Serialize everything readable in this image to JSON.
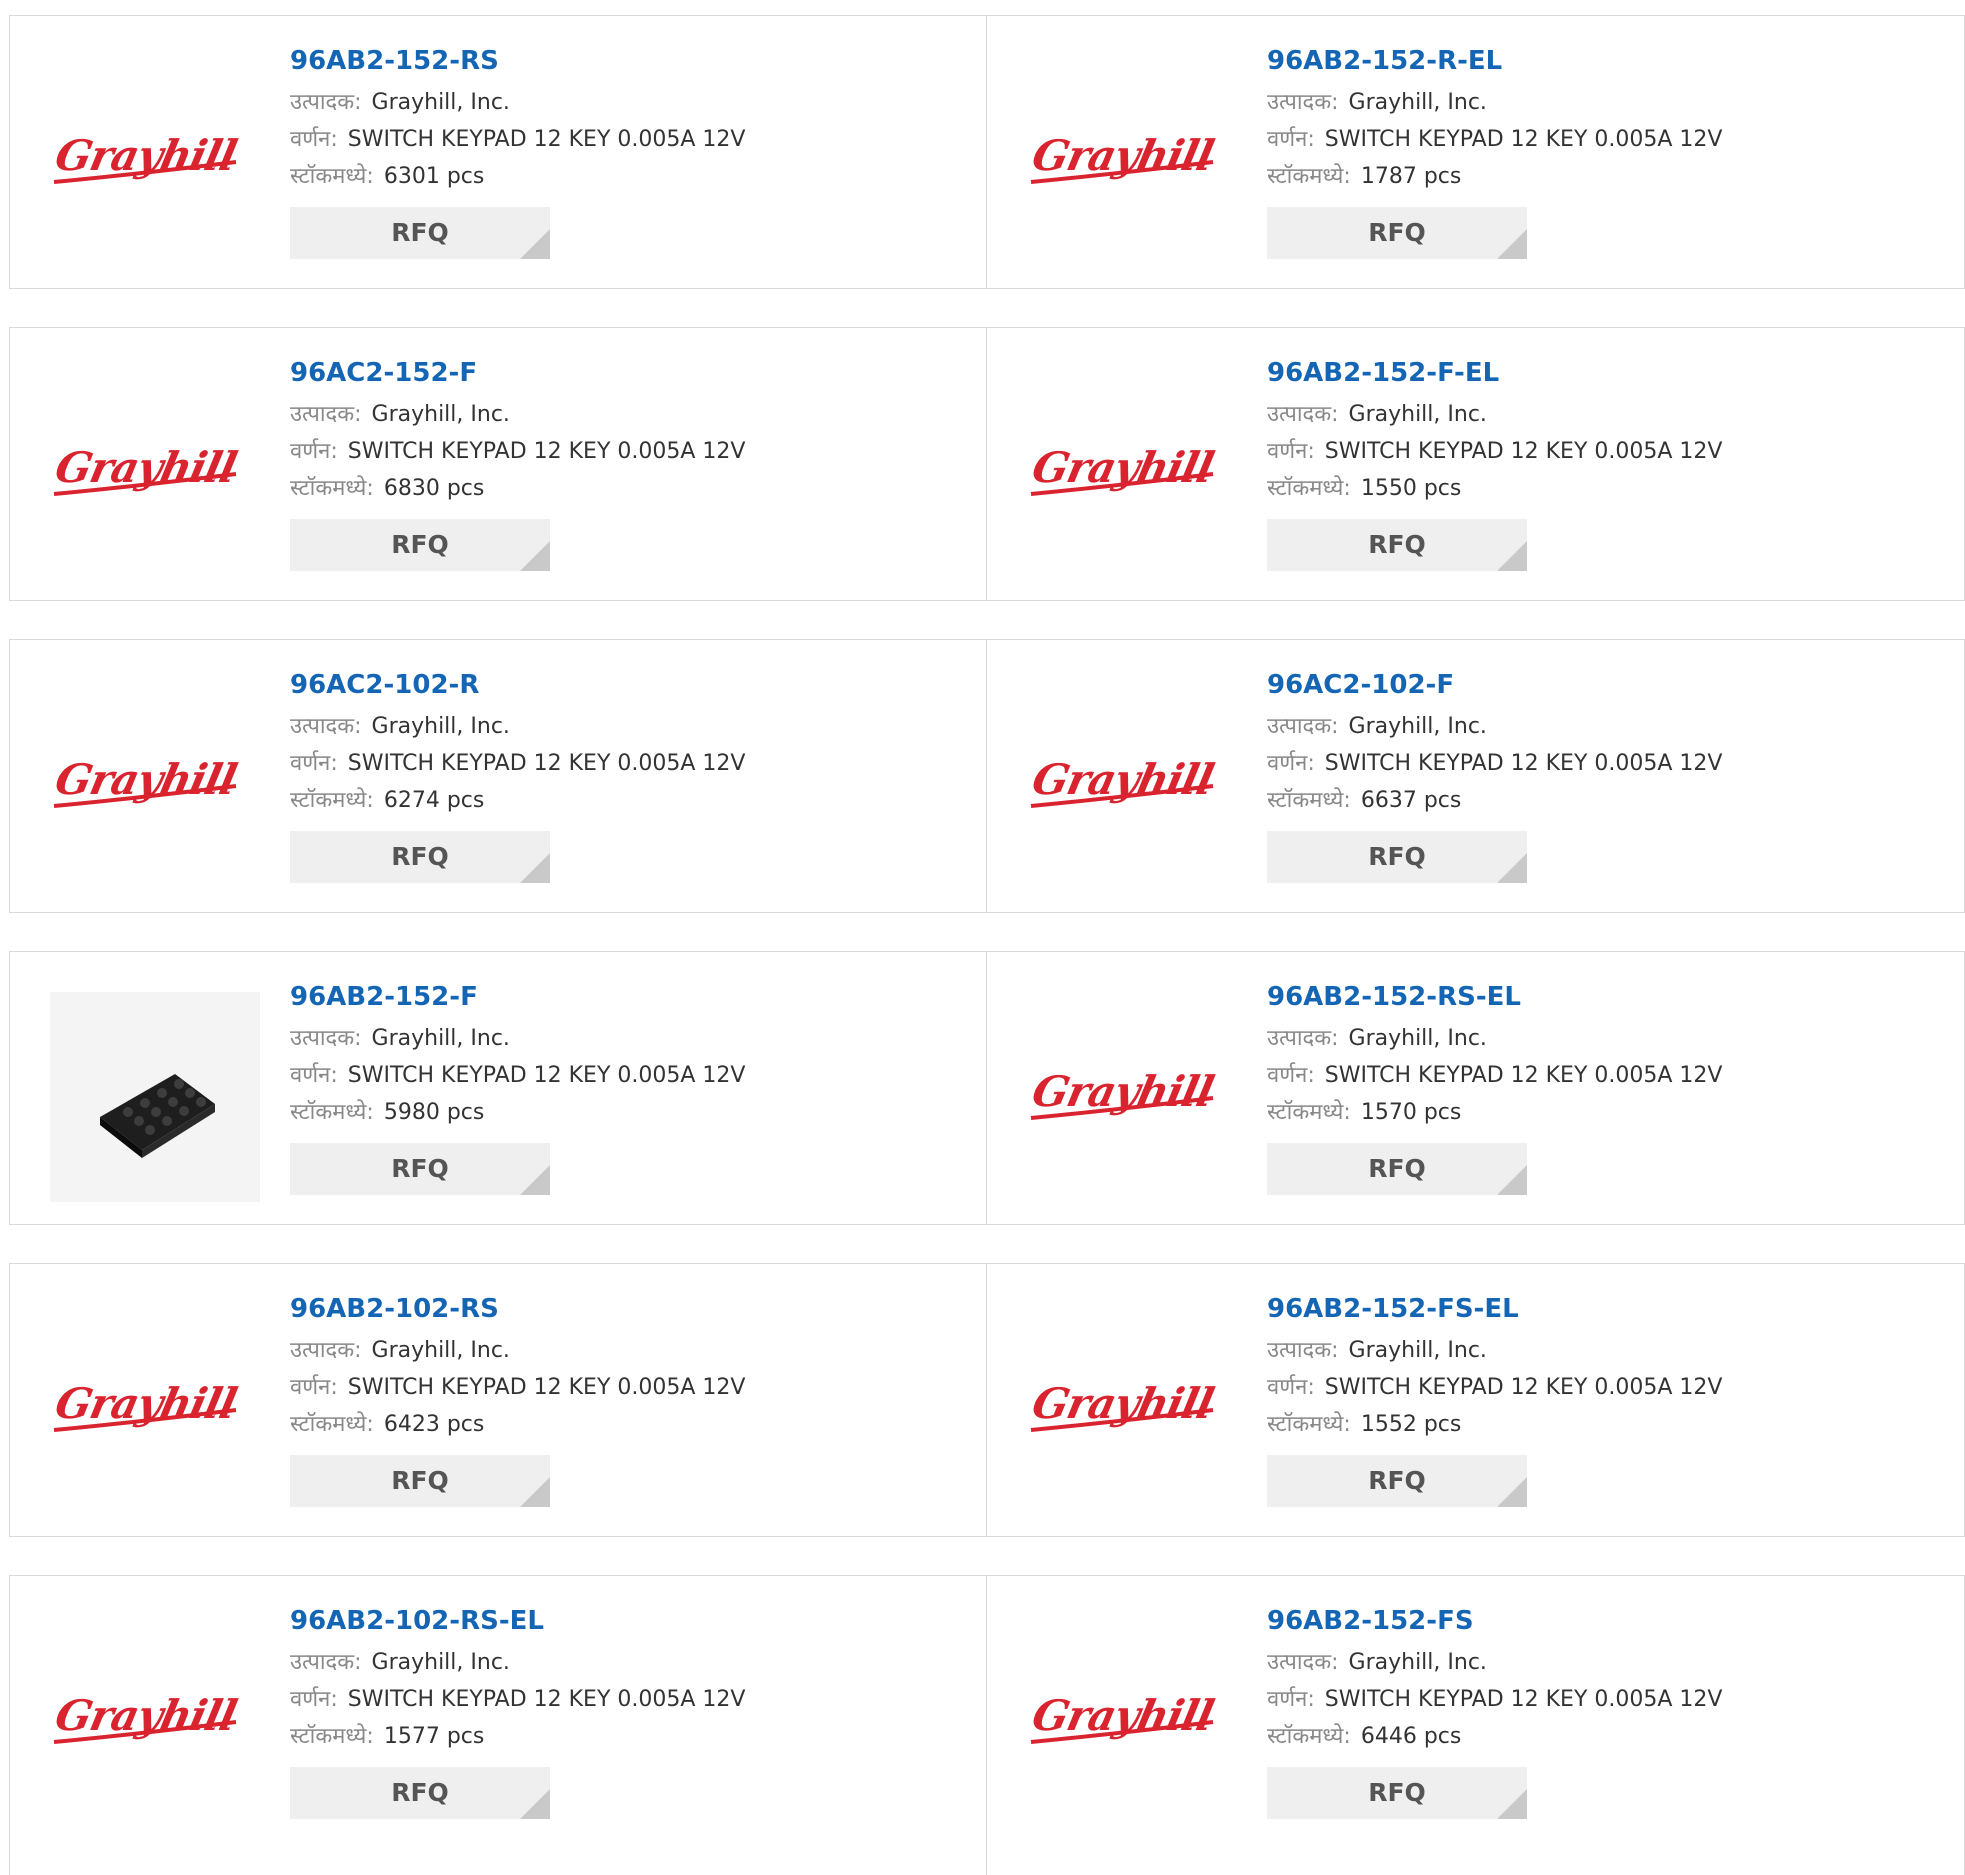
{
  "labels": {
    "manufacturer": "उत्पादक:",
    "description": "वर्णन:",
    "stock": "स्टॉकमध्ये:",
    "rfq": "RFQ"
  },
  "brand_color": "#d9232e",
  "link_color": "#1565b5",
  "logo_text": "Grayhill",
  "products": [
    {
      "part": "96AB2-152-RS",
      "manufacturer": "Grayhill, Inc.",
      "description": "SWITCH KEYPAD 12 KEY 0.005A 12V",
      "stock": "6301 pcs",
      "image": "grayhill-logo"
    },
    {
      "part": "96AB2-152-R-EL",
      "manufacturer": "Grayhill, Inc.",
      "description": "SWITCH KEYPAD 12 KEY 0.005A 12V",
      "stock": "1787 pcs",
      "image": "grayhill-logo"
    },
    {
      "part": "96AC2-152-F",
      "manufacturer": "Grayhill, Inc.",
      "description": "SWITCH KEYPAD 12 KEY 0.005A 12V",
      "stock": "6830 pcs",
      "image": "grayhill-logo"
    },
    {
      "part": "96AB2-152-F-EL",
      "manufacturer": "Grayhill, Inc.",
      "description": "SWITCH KEYPAD 12 KEY 0.005A 12V",
      "stock": "1550 pcs",
      "image": "grayhill-logo"
    },
    {
      "part": "96AC2-102-R",
      "manufacturer": "Grayhill, Inc.",
      "description": "SWITCH KEYPAD 12 KEY 0.005A 12V",
      "stock": "6274 pcs",
      "image": "grayhill-logo"
    },
    {
      "part": "96AC2-102-F",
      "manufacturer": "Grayhill, Inc.",
      "description": "SWITCH KEYPAD 12 KEY 0.005A 12V",
      "stock": "6637 pcs",
      "image": "grayhill-logo"
    },
    {
      "part": "96AB2-152-F",
      "manufacturer": "Grayhill, Inc.",
      "description": "SWITCH KEYPAD 12 KEY 0.005A 12V",
      "stock": "5980 pcs",
      "image": "keypad-photo"
    },
    {
      "part": "96AB2-152-RS-EL",
      "manufacturer": "Grayhill, Inc.",
      "description": "SWITCH KEYPAD 12 KEY 0.005A 12V",
      "stock": "1570 pcs",
      "image": "grayhill-logo"
    },
    {
      "part": "96AB2-102-RS",
      "manufacturer": "Grayhill, Inc.",
      "description": "SWITCH KEYPAD 12 KEY 0.005A 12V",
      "stock": "6423 pcs",
      "image": "grayhill-logo"
    },
    {
      "part": "96AB2-152-FS-EL",
      "manufacturer": "Grayhill, Inc.",
      "description": "SWITCH KEYPAD 12 KEY 0.005A 12V",
      "stock": "1552 pcs",
      "image": "grayhill-logo"
    },
    {
      "part": "96AB2-102-RS-EL",
      "manufacturer": "Grayhill, Inc.",
      "description": "SWITCH KEYPAD 12 KEY 0.005A 12V",
      "stock": "1577 pcs",
      "image": "grayhill-logo"
    },
    {
      "part": "96AB2-152-FS",
      "manufacturer": "Grayhill, Inc.",
      "description": "SWITCH KEYPAD 12 KEY 0.005A 12V",
      "stock": "6446 pcs",
      "image": "grayhill-logo"
    }
  ]
}
